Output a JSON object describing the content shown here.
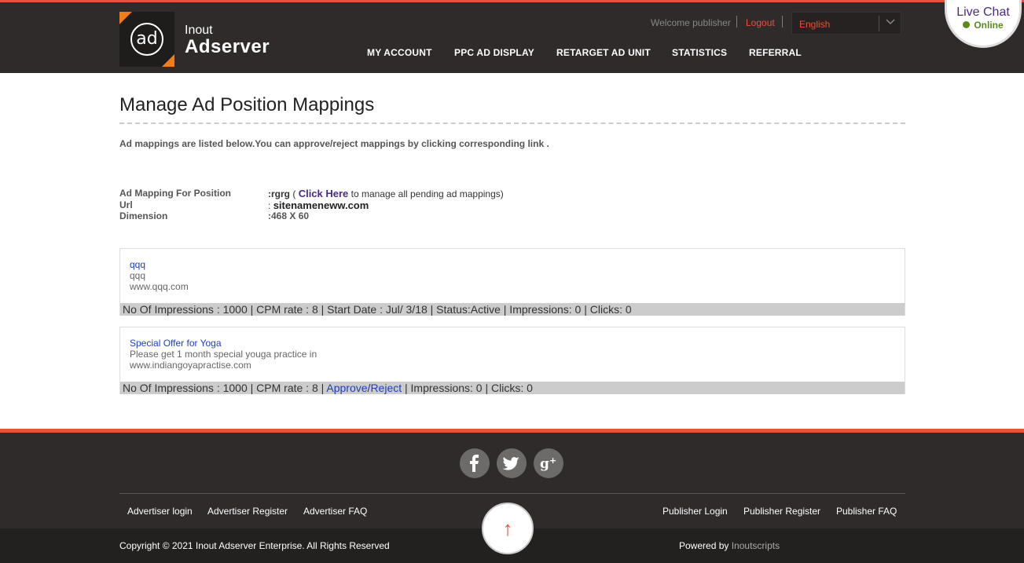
{
  "header": {
    "logo_text_top": "Inout",
    "logo_text_bottom": "Adserver",
    "logo_mark": "ad",
    "welcome": "Welcome publisher",
    "logout": "Logout",
    "language": "English",
    "nav": [
      "MY ACCOUNT",
      "PPC AD DISPLAY",
      "RETARGET AD UNIT",
      "STATISTICS",
      "REFERRAL"
    ]
  },
  "live_chat": {
    "title": "Live Chat",
    "status": "Online"
  },
  "main": {
    "title": "Manage Ad Position Mappings",
    "intro": "Ad mappings are listed below.You can approve/reject mappings by clicking corresponding link .",
    "info": {
      "position_label": "Ad Mapping For Position",
      "position_value": ":rgrg",
      "open_paren": "(",
      "click_here": "Click Here",
      "click_suffix": "to manage all pending ad mappings)",
      "url_label": "Url",
      "url_sep": ":",
      "url_value": "sitenameneww.com",
      "dimension_label": "Dimension",
      "dimension_value": ":468 X 60"
    },
    "ads": [
      {
        "title": "qqq",
        "line1": "qqq",
        "line2": "www.qqq.com",
        "stats_prefix": "No Of Impressions : 1000 |  CPM rate : 8 | Start Date : Jul/ 3/18  |  Status:Active | Impressions: 0 | Clicks: 0"
      },
      {
        "title": "Special Offer for Yoga",
        "line1": "Please get 1 month special youga practice in",
        "line2": "www.indiangoyapractise.com",
        "stats_prefix": "No Of Impressions : 1000 |  CPM rate : 8 | ",
        "approve": "Approve",
        "slash": "/",
        "reject": "Reject",
        "stats_suffix": " | Impressions: 0 | Clicks: 0"
      }
    ]
  },
  "footer": {
    "social": [
      "facebook-icon",
      "twitter-icon",
      "google-plus-icon"
    ],
    "social_glyphs": [
      "f",
      "t",
      "g+"
    ],
    "links_left": [
      "Advertiser login",
      "Advertiser Register",
      "Advertiser FAQ"
    ],
    "links_right": [
      "Publisher Login",
      "Publisher Register",
      "Publisher FAQ"
    ],
    "copyright": "Copyright © 2021 Inout Adserver Enterprise. All Rights Reserved",
    "powered_by": "Powered by",
    "powered_brand": "Inoutscripts",
    "scroll_top": "↑"
  },
  "colors": {
    "accent": "#e8523a",
    "header_bg": "#2e2b2a",
    "link": "#1f3fbf",
    "chat_purple": "#4b2a84"
  }
}
